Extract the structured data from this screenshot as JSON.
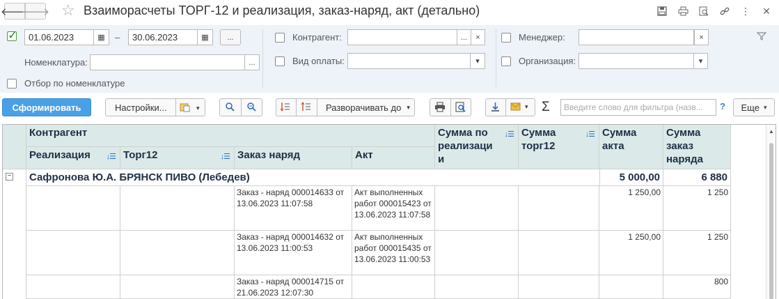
{
  "window": {
    "title": "Взаиморасчеты ТОРГ-12  и реализация, заказ-наряд, акт (детально)"
  },
  "filters": {
    "period_checked": true,
    "date_from": "01.06.2023",
    "date_separator": "–",
    "date_to": "30.06.2023",
    "period_button": "...",
    "nomenclature_label": "Номенклатура:",
    "nomenclature_value": "",
    "nomenclature_filter_label": "Отбор по номенклатуре",
    "kontragent_label": "Контрагент:",
    "kontragent_value": "",
    "payment_type_label": "Вид оплаты:",
    "payment_type_value": "",
    "manager_label": "Менеджер:",
    "manager_value": "",
    "organization_label": "Организация:",
    "organization_value": "",
    "dots": "...",
    "clear": "×"
  },
  "toolbar": {
    "generate": "Сформировать",
    "settings": "Настройки...",
    "expand_to": "Разворачивать до",
    "search_placeholder": "Введите слово для фильтра (назв...",
    "help": "?",
    "more": "Еще"
  },
  "table": {
    "headers": {
      "kontragent": "Контрагент",
      "realizaciya": "Реализация",
      "torg12": "Торг12",
      "zakaz_naryad": "Заказ наряд",
      "akt": "Акт",
      "summa_realizacii": "Сумма по реализаци и",
      "summa_torg12": "Сумма торг12",
      "summa_akta": "Сумма акта",
      "summa_zakaz_naryada": "Сумма заказ наряда"
    },
    "group": {
      "name": "Сафронова Ю.А. БРЯНСК ПИВО (Лебедев)",
      "summa_akta": "5 000,00",
      "summa_zakaz_naryada": "6 880"
    },
    "rows": [
      {
        "zakaz_naryad": "Заказ - наряд 000014633 от 13.06.2023 11:07:58",
        "akt": "Акт выполненных работ 000015423 от 13.06.2023 11:07:58",
        "summa_akta": "1 250,00",
        "summa_zakaz_naryada": "1 250"
      },
      {
        "zakaz_naryad": "Заказ - наряд 000014632 от 13.06.2023 11:00:53",
        "akt": "Акт выполненных работ 000015435 от 13.06.2023 11:00:53",
        "summa_akta": "1 250,00",
        "summa_zakaz_naryada": "1 250"
      },
      {
        "zakaz_naryad": "Заказ - наряд 000014715 от 21.06.2023 12:07:30",
        "akt": "",
        "summa_akta": "",
        "summa_zakaz_naryada": "800"
      }
    ]
  },
  "colors": {
    "header_bg": "#dbeae9",
    "filter_bg": "#eef3f9",
    "primary_button": "#4aa0e6"
  }
}
